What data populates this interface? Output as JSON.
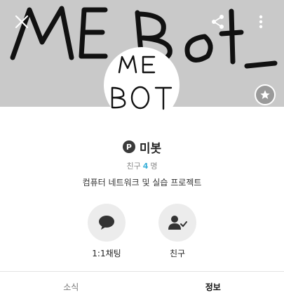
{
  "header": {
    "banner_text": "ME Bot",
    "close_icon": "close-icon",
    "share_icon": "share-icon",
    "more_icon": "more-vertical-icon",
    "star_icon": "star-icon"
  },
  "profile": {
    "avatar_line1": "ME",
    "avatar_line2": "BOT",
    "badge": "P",
    "name": "미봇",
    "friends_prefix": "친구",
    "friends_count": "4",
    "friends_suffix": "명",
    "description": "컴퓨터 네트워크 및 실습 프로젝트"
  },
  "actions": [
    {
      "label": "1:1채팅",
      "icon": "chat-bubble-icon"
    },
    {
      "label": "친구",
      "icon": "friend-check-icon"
    }
  ],
  "tabs": [
    {
      "label": "소식",
      "active": false
    },
    {
      "label": "정보",
      "active": true
    }
  ],
  "colors": {
    "banner_bg": "#c9c9c9",
    "friends_count": "#3ab0d9",
    "action_bg": "#ececec"
  }
}
